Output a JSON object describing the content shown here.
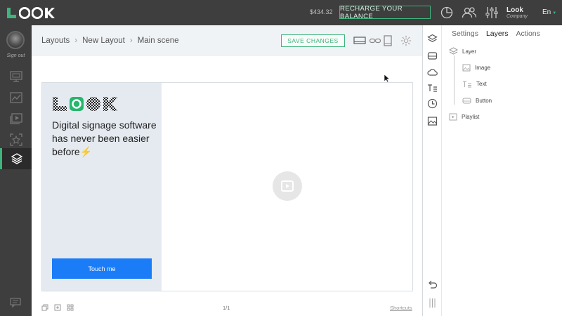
{
  "topbar": {
    "balance": "$434.32",
    "recharge_label": "RECHARGE YOUR BALANCE",
    "account_name": "Look",
    "account_role": "Company",
    "language": "En",
    "icons": [
      "pie-chart-icon",
      "users-icon",
      "sliders-icon"
    ]
  },
  "sidebar": {
    "signout_label": "Sign out",
    "items": [
      {
        "icon": "monitor-icon"
      },
      {
        "icon": "chart-icon"
      },
      {
        "icon": "playlist-icon"
      },
      {
        "icon": "crop-icon"
      },
      {
        "icon": "layers-icon",
        "active": true
      }
    ],
    "bottom_icon": "chat-icon"
  },
  "header": {
    "breadcrumb": [
      "Layouts",
      "New Layout",
      "Main scene"
    ],
    "save_label": "SAVE CHANGES",
    "icons": [
      "landscape-icon",
      "link-icon",
      "portrait-icon",
      "settings-icon"
    ]
  },
  "scene": {
    "headline": "Digital signage software has never been easier before⚡",
    "button_label": "Touch me",
    "page_indicator": "1/1",
    "shortcuts_label": "Shortcuts"
  },
  "right_panel": {
    "tabs": [
      {
        "label": "Settings",
        "active": false
      },
      {
        "label": "Layers",
        "active": true
      },
      {
        "label": "Actions",
        "active": false
      }
    ],
    "layers": [
      {
        "label": "Layer",
        "icon": "layer-icon"
      },
      {
        "label": "Image",
        "icon": "image-icon"
      },
      {
        "label": "Text",
        "icon": "text-icon"
      },
      {
        "label": "Button",
        "icon": "button-icon"
      },
      {
        "label": "Playlist",
        "icon": "playlist-icon"
      }
    ],
    "tools": [
      "layers-icon",
      "storage-icon",
      "cloud-icon",
      "text-icon",
      "clock-icon",
      "image-icon",
      "undo-icon",
      "drag-handle-icon"
    ]
  },
  "colors": {
    "accent": "#3fb47c",
    "topbar_bg": "#3e3e3e",
    "button_blue": "#1a7cf7"
  }
}
